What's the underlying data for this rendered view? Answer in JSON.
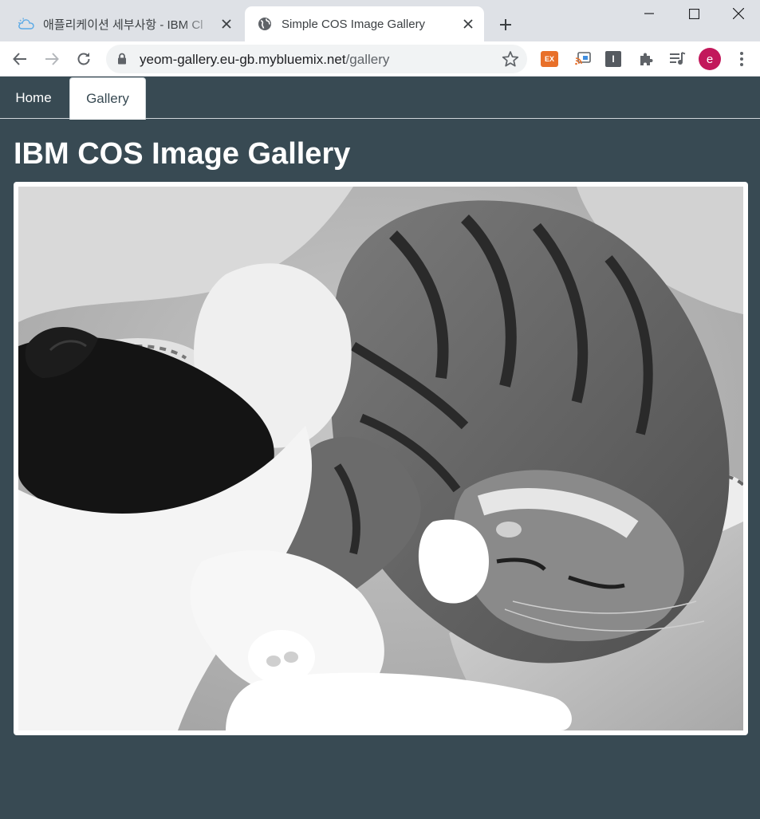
{
  "browser": {
    "tabs": [
      {
        "title": "애플리케이션 세부사항 - IBM Cl",
        "icon": "cloud-icon",
        "active": false
      },
      {
        "title": "Simple COS Image Gallery",
        "icon": "globe-icon",
        "active": true
      }
    ],
    "url_host": "yeom-gallery.eu-gb.mybluemix.net",
    "url_path": "/gallery",
    "extensions": {
      "ex_label": "EX",
      "i_label": "I"
    },
    "profile_initial": "e"
  },
  "site": {
    "nav": [
      {
        "label": "Home",
        "active": false
      },
      {
        "label": "Gallery",
        "active": true
      }
    ],
    "page_title": "IBM COS Image Gallery",
    "image": {
      "subject": "grayscale photo of two cats sleeping",
      "icon": "photo"
    }
  },
  "colors": {
    "page_bg": "#384a53",
    "tabstrip_bg": "#dee1e6",
    "avatar": "#c2185b",
    "ext_ex": "#e8702a"
  }
}
